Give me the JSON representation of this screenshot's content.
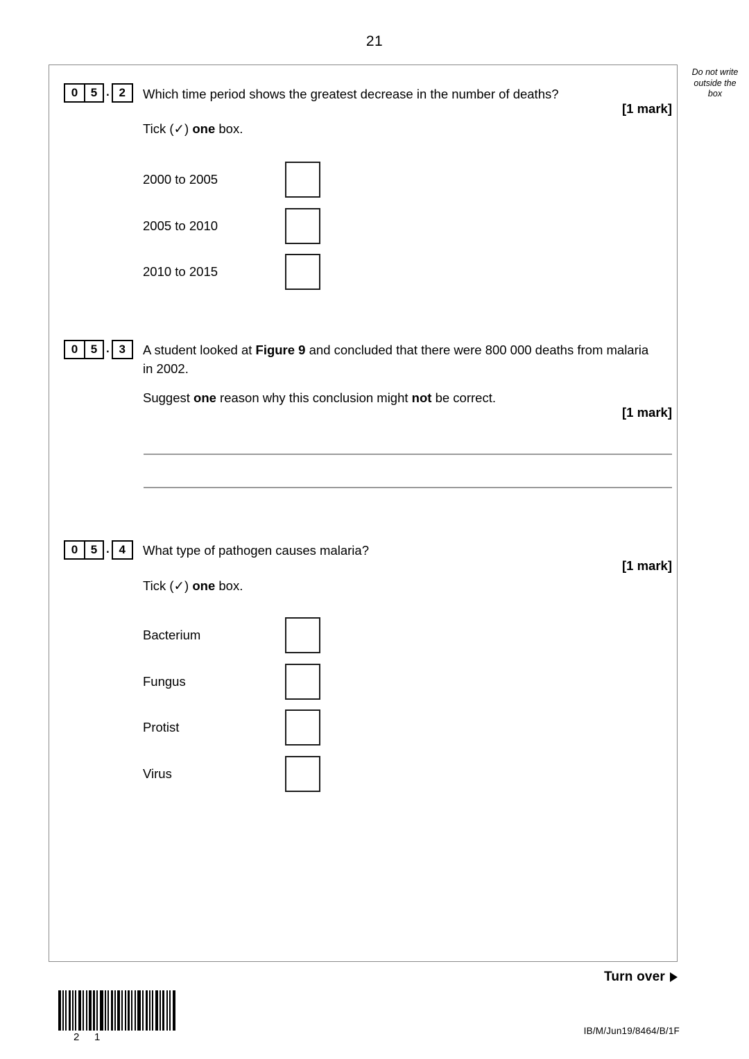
{
  "page": {
    "number": "21",
    "margin_note_line1": "Do not write",
    "margin_note_line2": "outside the",
    "margin_note_line3": "box"
  },
  "questions": [
    {
      "id": "05.2",
      "num_digits": [
        "0",
        "5"
      ],
      "num_separator": ".",
      "num_sub": "2",
      "prompt": "Which time period shows the greatest decrease in the number of deaths?",
      "marks": "[1 mark]",
      "instruction_prefix": "Tick (",
      "instruction_tick": "✓",
      "instruction_mid": ") ",
      "instruction_bold": "one",
      "instruction_suffix": " box.",
      "options": [
        {
          "label": "2000 to 2005"
        },
        {
          "label": "2005 to 2010"
        },
        {
          "label": "2010 to 2015"
        }
      ]
    },
    {
      "id": "05.3",
      "num_digits": [
        "0",
        "5"
      ],
      "num_separator": ".",
      "num_sub": "3",
      "prompt_part1": "A student looked at ",
      "prompt_bold1": "Figure 9",
      "prompt_part2": " and concluded that there were 800 000 deaths from malaria in 2002.",
      "prompt2_part1": "Suggest ",
      "prompt2_bold1": "one",
      "prompt2_part2": " reason why this conclusion might ",
      "prompt2_bold2": "not",
      "prompt2_part3": " be correct.",
      "marks": "[1 mark]",
      "answer_lines": 2
    },
    {
      "id": "05.4",
      "num_digits": [
        "0",
        "5"
      ],
      "num_separator": ".",
      "num_sub": "4",
      "prompt": "What type of pathogen causes malaria?",
      "marks": "[1 mark]",
      "instruction_prefix": "Tick (",
      "instruction_tick": "✓",
      "instruction_mid": ") ",
      "instruction_bold": "one",
      "instruction_suffix": " box.",
      "options": [
        {
          "label": "Bacterium"
        },
        {
          "label": "Fungus"
        },
        {
          "label": "Protist"
        },
        {
          "label": "Virus"
        }
      ]
    }
  ],
  "footer": {
    "turn_over": "Turn over",
    "document_code": "IB/M/Jun19/8464/B/1F",
    "barcode_digit_left": "2",
    "barcode_digit_right": "1"
  }
}
